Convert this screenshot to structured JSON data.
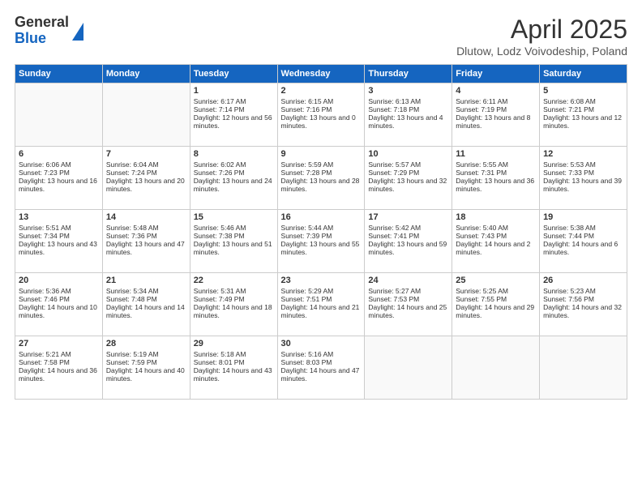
{
  "logo": {
    "general": "General",
    "blue": "Blue"
  },
  "header": {
    "month": "April 2025",
    "location": "Dlutow, Lodz Voivodeship, Poland"
  },
  "weekdays": [
    "Sunday",
    "Monday",
    "Tuesday",
    "Wednesday",
    "Thursday",
    "Friday",
    "Saturday"
  ],
  "weeks": [
    [
      {
        "day": "",
        "content": ""
      },
      {
        "day": "",
        "content": ""
      },
      {
        "day": "1",
        "content": "Sunrise: 6:17 AM\nSunset: 7:14 PM\nDaylight: 12 hours and 56 minutes."
      },
      {
        "day": "2",
        "content": "Sunrise: 6:15 AM\nSunset: 7:16 PM\nDaylight: 13 hours and 0 minutes."
      },
      {
        "day": "3",
        "content": "Sunrise: 6:13 AM\nSunset: 7:18 PM\nDaylight: 13 hours and 4 minutes."
      },
      {
        "day": "4",
        "content": "Sunrise: 6:11 AM\nSunset: 7:19 PM\nDaylight: 13 hours and 8 minutes."
      },
      {
        "day": "5",
        "content": "Sunrise: 6:08 AM\nSunset: 7:21 PM\nDaylight: 13 hours and 12 minutes."
      }
    ],
    [
      {
        "day": "6",
        "content": "Sunrise: 6:06 AM\nSunset: 7:23 PM\nDaylight: 13 hours and 16 minutes."
      },
      {
        "day": "7",
        "content": "Sunrise: 6:04 AM\nSunset: 7:24 PM\nDaylight: 13 hours and 20 minutes."
      },
      {
        "day": "8",
        "content": "Sunrise: 6:02 AM\nSunset: 7:26 PM\nDaylight: 13 hours and 24 minutes."
      },
      {
        "day": "9",
        "content": "Sunrise: 5:59 AM\nSunset: 7:28 PM\nDaylight: 13 hours and 28 minutes."
      },
      {
        "day": "10",
        "content": "Sunrise: 5:57 AM\nSunset: 7:29 PM\nDaylight: 13 hours and 32 minutes."
      },
      {
        "day": "11",
        "content": "Sunrise: 5:55 AM\nSunset: 7:31 PM\nDaylight: 13 hours and 36 minutes."
      },
      {
        "day": "12",
        "content": "Sunrise: 5:53 AM\nSunset: 7:33 PM\nDaylight: 13 hours and 39 minutes."
      }
    ],
    [
      {
        "day": "13",
        "content": "Sunrise: 5:51 AM\nSunset: 7:34 PM\nDaylight: 13 hours and 43 minutes."
      },
      {
        "day": "14",
        "content": "Sunrise: 5:48 AM\nSunset: 7:36 PM\nDaylight: 13 hours and 47 minutes."
      },
      {
        "day": "15",
        "content": "Sunrise: 5:46 AM\nSunset: 7:38 PM\nDaylight: 13 hours and 51 minutes."
      },
      {
        "day": "16",
        "content": "Sunrise: 5:44 AM\nSunset: 7:39 PM\nDaylight: 13 hours and 55 minutes."
      },
      {
        "day": "17",
        "content": "Sunrise: 5:42 AM\nSunset: 7:41 PM\nDaylight: 13 hours and 59 minutes."
      },
      {
        "day": "18",
        "content": "Sunrise: 5:40 AM\nSunset: 7:43 PM\nDaylight: 14 hours and 2 minutes."
      },
      {
        "day": "19",
        "content": "Sunrise: 5:38 AM\nSunset: 7:44 PM\nDaylight: 14 hours and 6 minutes."
      }
    ],
    [
      {
        "day": "20",
        "content": "Sunrise: 5:36 AM\nSunset: 7:46 PM\nDaylight: 14 hours and 10 minutes."
      },
      {
        "day": "21",
        "content": "Sunrise: 5:34 AM\nSunset: 7:48 PM\nDaylight: 14 hours and 14 minutes."
      },
      {
        "day": "22",
        "content": "Sunrise: 5:31 AM\nSunset: 7:49 PM\nDaylight: 14 hours and 18 minutes."
      },
      {
        "day": "23",
        "content": "Sunrise: 5:29 AM\nSunset: 7:51 PM\nDaylight: 14 hours and 21 minutes."
      },
      {
        "day": "24",
        "content": "Sunrise: 5:27 AM\nSunset: 7:53 PM\nDaylight: 14 hours and 25 minutes."
      },
      {
        "day": "25",
        "content": "Sunrise: 5:25 AM\nSunset: 7:55 PM\nDaylight: 14 hours and 29 minutes."
      },
      {
        "day": "26",
        "content": "Sunrise: 5:23 AM\nSunset: 7:56 PM\nDaylight: 14 hours and 32 minutes."
      }
    ],
    [
      {
        "day": "27",
        "content": "Sunrise: 5:21 AM\nSunset: 7:58 PM\nDaylight: 14 hours and 36 minutes."
      },
      {
        "day": "28",
        "content": "Sunrise: 5:19 AM\nSunset: 7:59 PM\nDaylight: 14 hours and 40 minutes."
      },
      {
        "day": "29",
        "content": "Sunrise: 5:18 AM\nSunset: 8:01 PM\nDaylight: 14 hours and 43 minutes."
      },
      {
        "day": "30",
        "content": "Sunrise: 5:16 AM\nSunset: 8:03 PM\nDaylight: 14 hours and 47 minutes."
      },
      {
        "day": "",
        "content": ""
      },
      {
        "day": "",
        "content": ""
      },
      {
        "day": "",
        "content": ""
      }
    ]
  ]
}
